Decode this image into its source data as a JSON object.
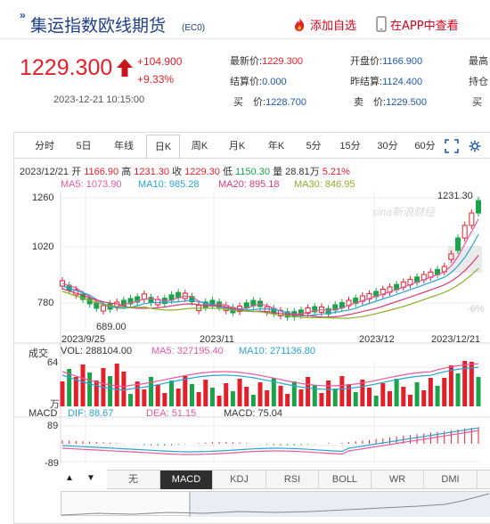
{
  "header": {
    "title": "集运指数欧线期货",
    "code": "(EC0)",
    "add_fav": "添加自选",
    "view_app": "在APP中查看"
  },
  "quote": {
    "price": "1229.300",
    "change": "+104.900",
    "change_pct": "+9.33%",
    "datetime": "2023-12-21 10:15:00",
    "fields": [
      {
        "label": "最新价:",
        "value": "1229.300"
      },
      {
        "label": "开盘价:",
        "value": "1166.900"
      },
      {
        "label": "最高",
        "value": ""
      },
      {
        "label": "结算价:",
        "value": "0.000"
      },
      {
        "label": "昨结算:",
        "value": "1124.400"
      },
      {
        "label": "持仓",
        "value": ""
      },
      {
        "label": "买　价:",
        "value": "1228.700"
      },
      {
        "label": "卖　价:",
        "value": "1229.500"
      },
      {
        "label": "买",
        "value": ""
      }
    ]
  },
  "chart_tabs": [
    "分时",
    "5日",
    "年线",
    "日K",
    "周K",
    "月K",
    "年K",
    "5分",
    "15分",
    "30分",
    "60分"
  ],
  "active_tab": "日K",
  "ohlc_line": {
    "date": "2023/12/21",
    "open_label": "开",
    "open": "1166.90",
    "high_label": "高",
    "high": "1231.30",
    "close_label": "收",
    "close": "1229.30",
    "low_label": "低",
    "low": "1150.30",
    "vol_label": "量",
    "vol": "28.81万",
    "pct": "5.21%"
  },
  "ma": {
    "ma5": "MA5: 1073.90",
    "ma10": "MA10: 985.28",
    "ma20": "MA20: 895.18",
    "ma30": "MA30: 846.95"
  },
  "price_axis": [
    "1260",
    "1020",
    "780"
  ],
  "low_label": "689.00",
  "high_label": "1231.30",
  "watermark": "sina新浪财经",
  "right_pct": "-6%",
  "date_axis": [
    "2023/9/25",
    "2023/11",
    "2023/12",
    "2023/12/21"
  ],
  "volume": {
    "title": "成交",
    "vol": "VOL: 288104.00",
    "ma5": "MA5: 327195.40",
    "ma10": "MA10: 271136.80",
    "axis_top": "64",
    "axis_bottom": "万"
  },
  "macd": {
    "title": "MACD",
    "dif": "DIF: 88.67",
    "dea": "DEA: 51.15",
    "macd": "MACD: 75.04",
    "axis_top": "89",
    "axis_bottom": "-89"
  },
  "indicator_tabs": [
    "无",
    "MACD",
    "KDJ",
    "RSI",
    "BOLL",
    "WR",
    "DMI"
  ],
  "active_indicator": "MACD",
  "colors": {
    "up": "#e3202a",
    "down": "#1aa34a",
    "ma5": "#e35a9f",
    "ma10": "#2aa3d8",
    "ma20": "#d63c7a",
    "ma30": "#8bb128",
    "brand_blue": "#1e3f8a"
  }
}
